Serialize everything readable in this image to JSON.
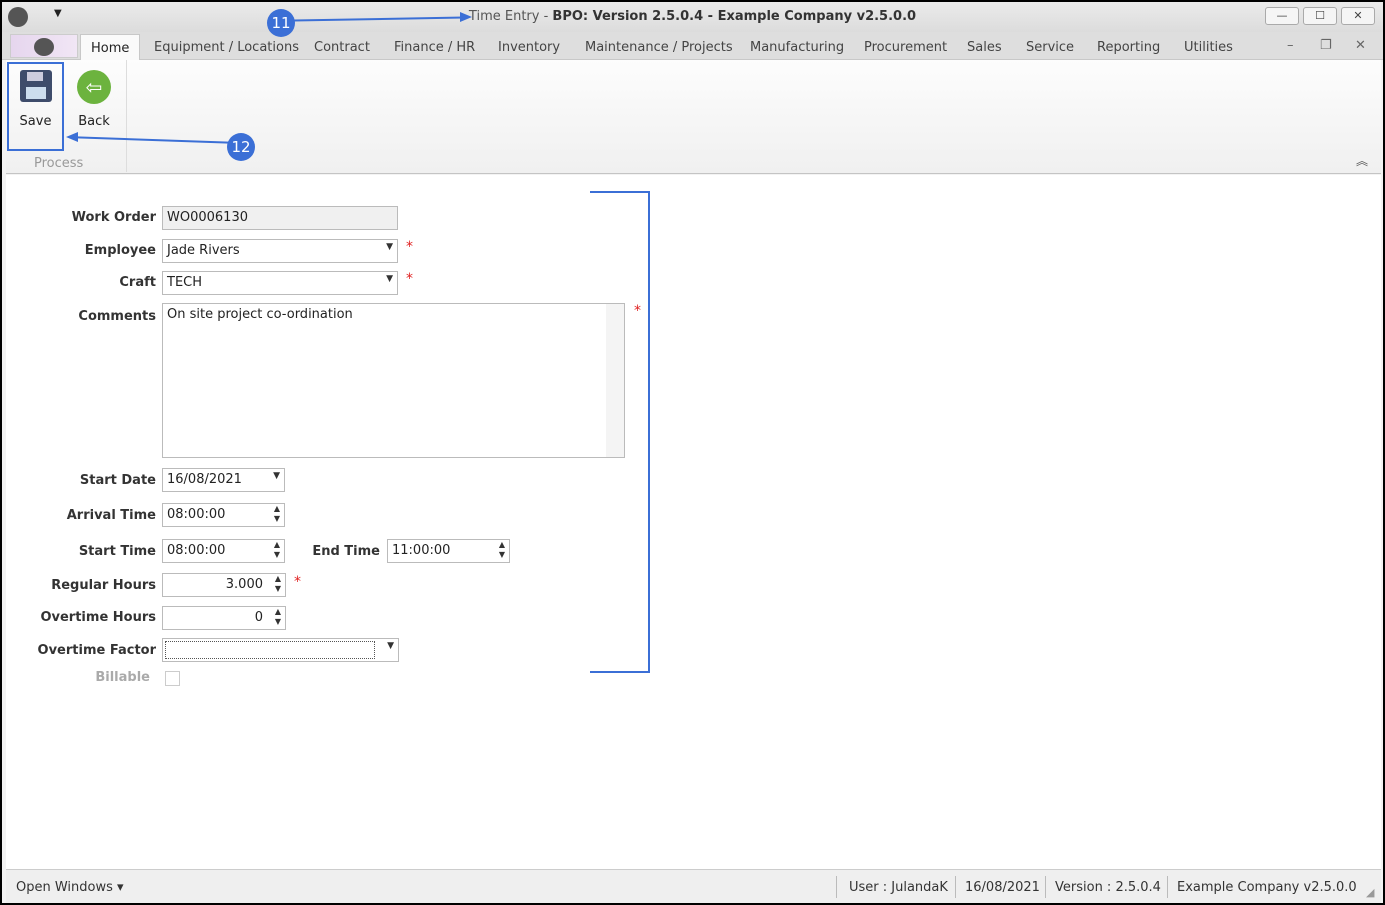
{
  "window": {
    "title_prefix": "Time Entry - ",
    "title_main": "BPO: Version 2.5.0.4 - Example Company v2.5.0.0",
    "minimize": "—",
    "maximize": "☐",
    "close": "✕"
  },
  "tabs": [
    "Home",
    "Equipment / Locations",
    "Contract",
    "Finance / HR",
    "Inventory",
    "Maintenance / Projects",
    "Manufacturing",
    "Procurement",
    "Sales",
    "Service",
    "Reporting",
    "Utilities"
  ],
  "ribbon": {
    "save": "Save",
    "back": "Back",
    "group": "Process"
  },
  "annotations": {
    "a11": "11",
    "a12": "12"
  },
  "form": {
    "work_order_label": "Work Order",
    "work_order": "WO0006130",
    "employee_label": "Employee",
    "employee": "Jade Rivers",
    "craft_label": "Craft",
    "craft": "TECH",
    "comments_label": "Comments",
    "comments": "On site project co-ordination",
    "start_date_label": "Start Date",
    "start_date": "16/08/2021",
    "arrival_time_label": "Arrival Time",
    "arrival_time": "08:00:00",
    "start_time_label": "Start Time",
    "start_time": "08:00:00",
    "end_time_label": "End Time",
    "end_time": "11:00:00",
    "regular_hours_label": "Regular Hours",
    "regular_hours": "3.000",
    "overtime_hours_label": "Overtime Hours",
    "overtime_hours": "0",
    "overtime_factor_label": "Overtime Factor",
    "overtime_factor": "",
    "billable_label": "Billable",
    "required": "*"
  },
  "status": {
    "open_windows": "Open Windows ▾",
    "user": "User : JulandaK",
    "date": "16/08/2021",
    "version": "Version : 2.5.0.4",
    "company": "Example Company v2.5.0.0"
  },
  "colors": {
    "accent": "#3b6fd6",
    "required": "#e02020"
  }
}
